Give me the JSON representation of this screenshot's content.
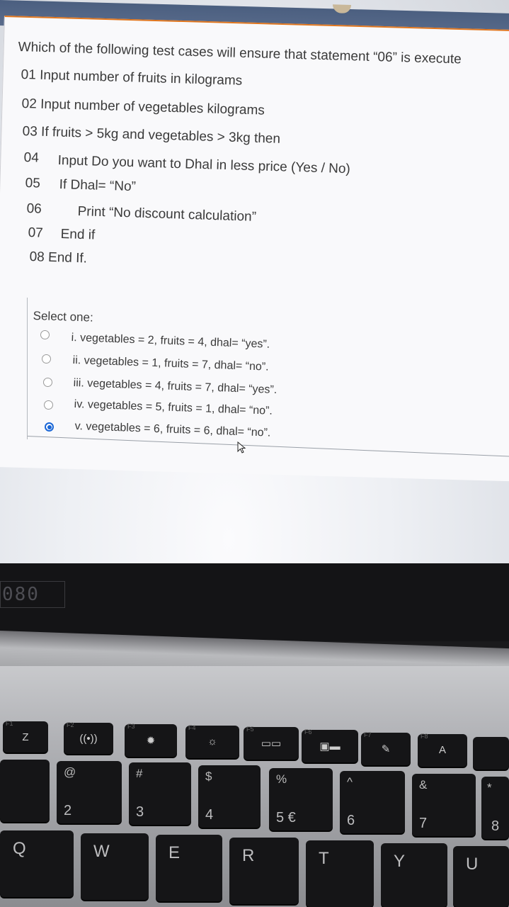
{
  "question": {
    "stem": "Which of the following test cases will ensure that statement “06” is execute",
    "lines": [
      "01 Input number of fruits in kilograms",
      "02 Input number of vegetables kilograms",
      "03 If fruits > 5kg and vegetables > 3kg then",
      "04",
      "Input Do you want to Dhal in less price (Yes / No)",
      "05",
      "If Dhal= “No”",
      "06",
      "Print “No discount calculation”",
      "07",
      "End if",
      "08 End If."
    ]
  },
  "select_label": "Select one:",
  "options": [
    {
      "label": "i. vegetables = 2, fruits = 4, dhal= “yes”.",
      "selected": false
    },
    {
      "label": "ii. vegetables = 1, fruits = 7, dhal= “no”.",
      "selected": false
    },
    {
      "label": "iii. vegetables = 4, fruits = 7, dhal= “yes”.",
      "selected": false
    },
    {
      "label": "iv. vegetables = 5, fruits = 1, dhal= “no”.",
      "selected": false
    },
    {
      "label": "v. vegetables = 6, fruits = 6, dhal= “no”.",
      "selected": true
    }
  ],
  "colors": {
    "accent": "#e0761e",
    "radio_selected": "#1a66d6"
  },
  "laptop": {
    "bezel_brand": "080",
    "keys": {
      "f1": {
        "fn": "F1",
        "label": "Z"
      },
      "f2": {
        "fn": "F2",
        "label": "((•))"
      },
      "f3": {
        "fn": "F3",
        "label": "✹"
      },
      "f4": {
        "fn": "F4",
        "label": "☼"
      },
      "f5": {
        "fn": "F5",
        "label": "▭▭"
      },
      "f6": {
        "fn": "F6",
        "label": "▣▬"
      },
      "f7": {
        "fn": "F7",
        "label": "✎"
      },
      "f8": {
        "fn": "F8",
        "label": "A"
      },
      "k2": {
        "top": "@",
        "bot": "2"
      },
      "k3": {
        "top": "#",
        "bot": "3"
      },
      "k4": {
        "top": "$",
        "bot": "4"
      },
      "k5": {
        "top": "%",
        "bot": "5  €"
      },
      "k6": {
        "top": "^",
        "bot": "6"
      },
      "k7": {
        "top": "&",
        "bot": "7"
      },
      "k8": {
        "top": "*",
        "bot": "8"
      },
      "q": "Q",
      "w": "W",
      "e": "E",
      "r": "R",
      "t": "T",
      "y": "Y",
      "u": "U"
    }
  }
}
